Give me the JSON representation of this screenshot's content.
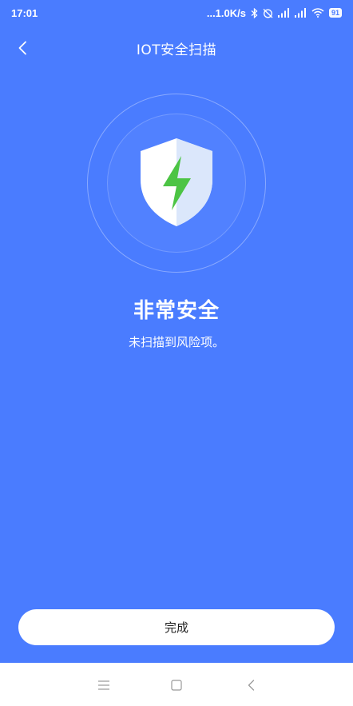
{
  "status_bar": {
    "time": "17:01",
    "speed": "...1.0K/s",
    "battery": "91"
  },
  "header": {
    "title": "IOT安全扫描"
  },
  "result": {
    "title": "非常安全",
    "subtitle": "未扫描到风险项。"
  },
  "actions": {
    "done_label": "完成"
  },
  "colors": {
    "background": "#4a7cff",
    "shield_bolt": "#4cc444",
    "button_bg": "#ffffff"
  },
  "icons": {
    "back": "chevron-left-icon",
    "shield": "shield-bolt-icon",
    "nav_menu": "menu-icon",
    "nav_home": "home-square-icon",
    "nav_back": "back-arrow-icon"
  }
}
